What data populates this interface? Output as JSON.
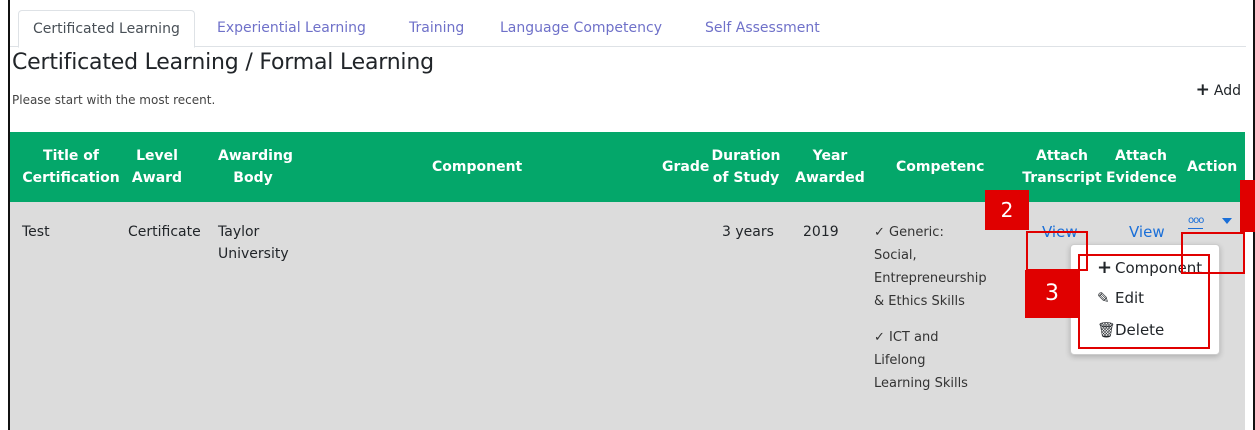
{
  "tabs": [
    {
      "label": "Certificated Learning",
      "active": true
    },
    {
      "label": "Experiential Learning",
      "active": false
    },
    {
      "label": "Training",
      "active": false
    },
    {
      "label": "Language Competency",
      "active": false
    },
    {
      "label": "Self Assessment",
      "active": false
    }
  ],
  "page": {
    "title": "Certificated Learning / Formal Learning",
    "subtitle": "Please start with the most recent.",
    "add_label": "Add"
  },
  "table": {
    "headers": {
      "title": [
        "Title of",
        "Certification"
      ],
      "level": [
        "Level",
        "Award"
      ],
      "body": [
        "Awarding",
        "Body"
      ],
      "component": "Component",
      "grade": "Grade",
      "duration": [
        "Duration",
        "of Study"
      ],
      "year": [
        "Year",
        "Awarded"
      ],
      "competency": "Competenc",
      "transcript": [
        "Attach",
        "Transcript"
      ],
      "evidence": [
        "Attach",
        "Evidence"
      ],
      "action": "Action"
    },
    "row": {
      "title": "Test",
      "level": "Certificate",
      "body": [
        "Taylor",
        "University"
      ],
      "duration": "3 years",
      "year": "2019",
      "competencies": [
        [
          "✓ Generic:",
          "Social,",
          "Entrepreneurship",
          "& Ethics Skills"
        ],
        [
          "✓ ICT and",
          "Lifelong",
          "Learning Skills"
        ]
      ],
      "transcript_link": "View",
      "evidence_link": "View",
      "action_dots": "ooo"
    }
  },
  "menu": {
    "items": [
      {
        "label": "Component",
        "icon": "plus-icon",
        "glyph": "+"
      },
      {
        "label": "Edit",
        "icon": "pencil-icon",
        "glyph": "✎"
      },
      {
        "label": "Delete",
        "icon": "trash-icon",
        "glyph": "🗑"
      }
    ]
  },
  "annotations": {
    "badge_2": "2",
    "badge_3": "3"
  },
  "colors": {
    "header_green": "#04a76a",
    "link_blue": "#1a6fd8",
    "highlight_red": "#e00000"
  }
}
